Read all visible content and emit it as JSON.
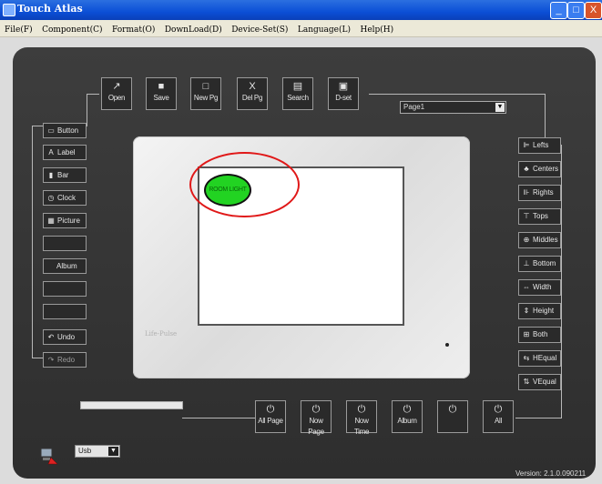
{
  "window": {
    "title": "Touch Atlas",
    "controls": [
      "_",
      "□",
      "X"
    ]
  },
  "menu": [
    "File(F)",
    "Component(C)",
    "Format(O)",
    "DownLoad(D)",
    "Device-Set(S)",
    "Language(L)",
    "Help(H)"
  ],
  "top_toolbar": [
    {
      "icon": "↗",
      "label": "Open"
    },
    {
      "icon": "■",
      "label": "Save"
    },
    {
      "icon": "□",
      "label": "New Pg"
    },
    {
      "icon": "X",
      "label": "Del Pg"
    },
    {
      "icon": "▤",
      "label": "Search"
    },
    {
      "icon": "▣",
      "label": "D-set"
    }
  ],
  "page_select": {
    "value": "Page1",
    "arrow": "▼"
  },
  "left_tools": [
    {
      "icon": "▭",
      "label": "Button"
    },
    {
      "icon": "A",
      "label": "Label"
    },
    {
      "icon": "▮",
      "label": "Bar"
    },
    {
      "icon": "◷",
      "label": "Clock"
    },
    {
      "icon": "▦",
      "label": "Picture"
    },
    {
      "icon": "",
      "label": ""
    },
    {
      "icon": "",
      "label": "Album"
    },
    {
      "icon": "",
      "label": ""
    },
    {
      "icon": "",
      "label": ""
    },
    {
      "icon": "↶",
      "label": "Undo"
    },
    {
      "icon": "↷",
      "label": "Redo"
    }
  ],
  "right_tools": [
    {
      "icon": "⊫",
      "label": "Lefts"
    },
    {
      "icon": "♣",
      "label": "Centers"
    },
    {
      "icon": "⊪",
      "label": "Rights"
    },
    {
      "icon": "⊤",
      "label": "Tops"
    },
    {
      "icon": "⊕",
      "label": "Middles"
    },
    {
      "icon": "⊥",
      "label": "Bottom"
    },
    {
      "icon": "⇔",
      "label": "Width"
    },
    {
      "icon": "⇕",
      "label": "Height"
    },
    {
      "icon": "⊞",
      "label": "Both"
    },
    {
      "icon": "⇆",
      "label": "HEqual"
    },
    {
      "icon": "⇅",
      "label": "VEqual"
    }
  ],
  "bottom_toolbar": [
    {
      "icon": "⏻",
      "label": "All Page"
    },
    {
      "icon": "⏻",
      "label": "Now Page"
    },
    {
      "icon": "⏻",
      "label": "Now Time"
    },
    {
      "icon": "⏻",
      "label": "Album"
    },
    {
      "icon": "⏻",
      "label": ""
    },
    {
      "icon": "⏻",
      "label": "All"
    }
  ],
  "device": {
    "brand": "Life-Pulse",
    "canvas_element": "ROOM LIGHT"
  },
  "connection": {
    "value": "Usb",
    "arrow": "▼"
  },
  "version": "Version: 2.1.0.090211",
  "colors": {
    "titlebar": "#0b4fd6",
    "board": "#363636",
    "highlight_ring": "#e01818",
    "room_button": "#22d322"
  }
}
